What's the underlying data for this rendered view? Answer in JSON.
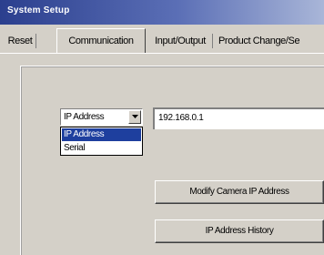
{
  "window": {
    "title": "System Setup"
  },
  "tabs": [
    {
      "label": "Reset",
      "active": false
    },
    {
      "label": "Communication",
      "active": true
    },
    {
      "label": "Input/Output",
      "active": false
    },
    {
      "label": "Product Change/Se",
      "active": false
    }
  ],
  "connection": {
    "selected": "IP Address",
    "options": [
      {
        "label": "IP Address",
        "highlighted": true
      },
      {
        "label": "Serial",
        "highlighted": false
      }
    ],
    "ip_value": "192.168.0.1"
  },
  "buttons": {
    "modify_label": "Modify Camera IP Address",
    "history_label": "IP Address History"
  },
  "colors": {
    "titlebar_start": "#2b3f8e",
    "selection": "#1e3f9e",
    "face": "#d4d0c8"
  }
}
